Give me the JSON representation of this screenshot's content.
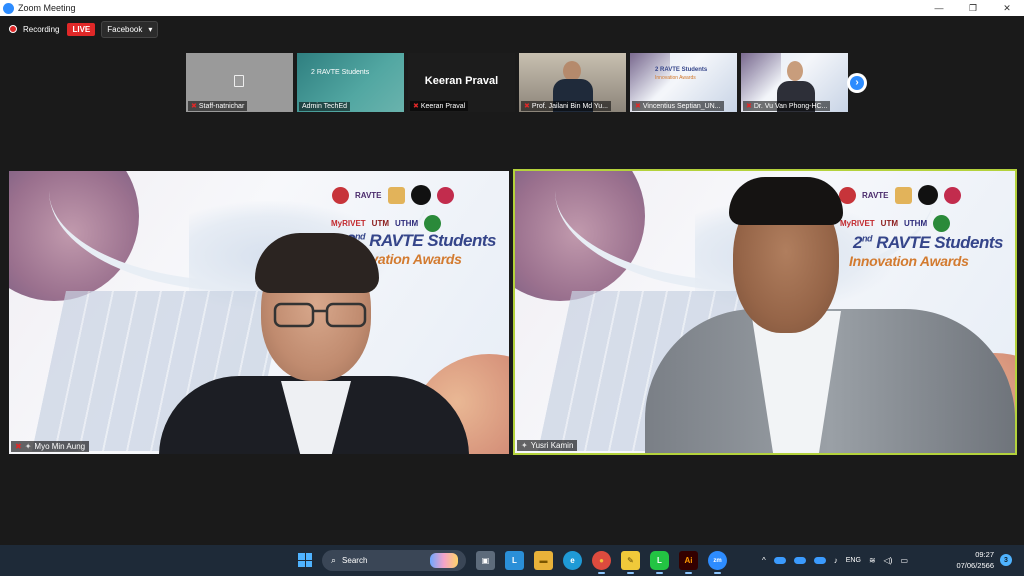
{
  "window": {
    "title": "Zoom Meeting",
    "app_icon": "zoom",
    "minimize_glyph": "—",
    "maximize_glyph": "❐",
    "close_glyph": "✕"
  },
  "recording": {
    "label": "Recording",
    "live_badge": "LIVE",
    "stream_target": "Facebook",
    "dropdown_glyph": "▾"
  },
  "thumbnails": [
    {
      "name": "Staff-natnichar",
      "kind": "no-video"
    },
    {
      "name": "Admin TechEd",
      "kind": "banner"
    },
    {
      "name": "Keeran Praval",
      "kind": "name-only",
      "display_name": "Keeran Praval"
    },
    {
      "name": "Prof. Jailani Bin Md Yu...",
      "kind": "office"
    },
    {
      "name": "Vincentius Septian_UN...",
      "kind": "banner"
    },
    {
      "name": "Dr. Vu Van Phong-HC...",
      "kind": "person"
    }
  ],
  "next_glyph": "›",
  "banner": {
    "headline_prefix": "2",
    "headline_sup": "nd",
    "headline_rest": " RAVTE Students",
    "subline": "Innovation Awards",
    "logo_ravte": "RAVTE",
    "logo_myrivet": "MyRIVET",
    "logo_utm": "UTM",
    "logo_uthm": "UTHM",
    "logo_hcmute": "HCMUTE"
  },
  "main_videos": {
    "left": {
      "name": "Myo Min Aung"
    },
    "right": {
      "name": "Yusri Kamin",
      "active_speaker": true
    }
  },
  "taskbar": {
    "search_placeholder": "Search",
    "search_glyph": "⌕",
    "apps": [
      {
        "name": "task-view",
        "glyph": "▣",
        "color": "#5d6b7b"
      },
      {
        "name": "l-app",
        "glyph": "L",
        "color": "#2a8fd8"
      },
      {
        "name": "file-explorer",
        "glyph": "▬",
        "color": "#e8b23a"
      },
      {
        "name": "edge",
        "glyph": "e",
        "color": "#1f9ad6"
      },
      {
        "name": "chrome",
        "glyph": "●",
        "color": "#dd4b3e"
      },
      {
        "name": "sticky-notes",
        "glyph": "✎",
        "color": "#f0c93a"
      },
      {
        "name": "line",
        "glyph": "L",
        "color": "#23c443"
      },
      {
        "name": "illustrator",
        "glyph": "Ai",
        "color": "#330000"
      },
      {
        "name": "zoom",
        "glyph": "zm",
        "color": "#2d8cff"
      }
    ],
    "tray": {
      "chevron_glyph": "^",
      "mic_glyph": "♪",
      "language": "ENG",
      "wifi_glyph": "≋",
      "volume_glyph": "◁)",
      "battery_glyph": "▭"
    },
    "time": "09:27",
    "date": "07/06/2566",
    "notifications": "3"
  }
}
